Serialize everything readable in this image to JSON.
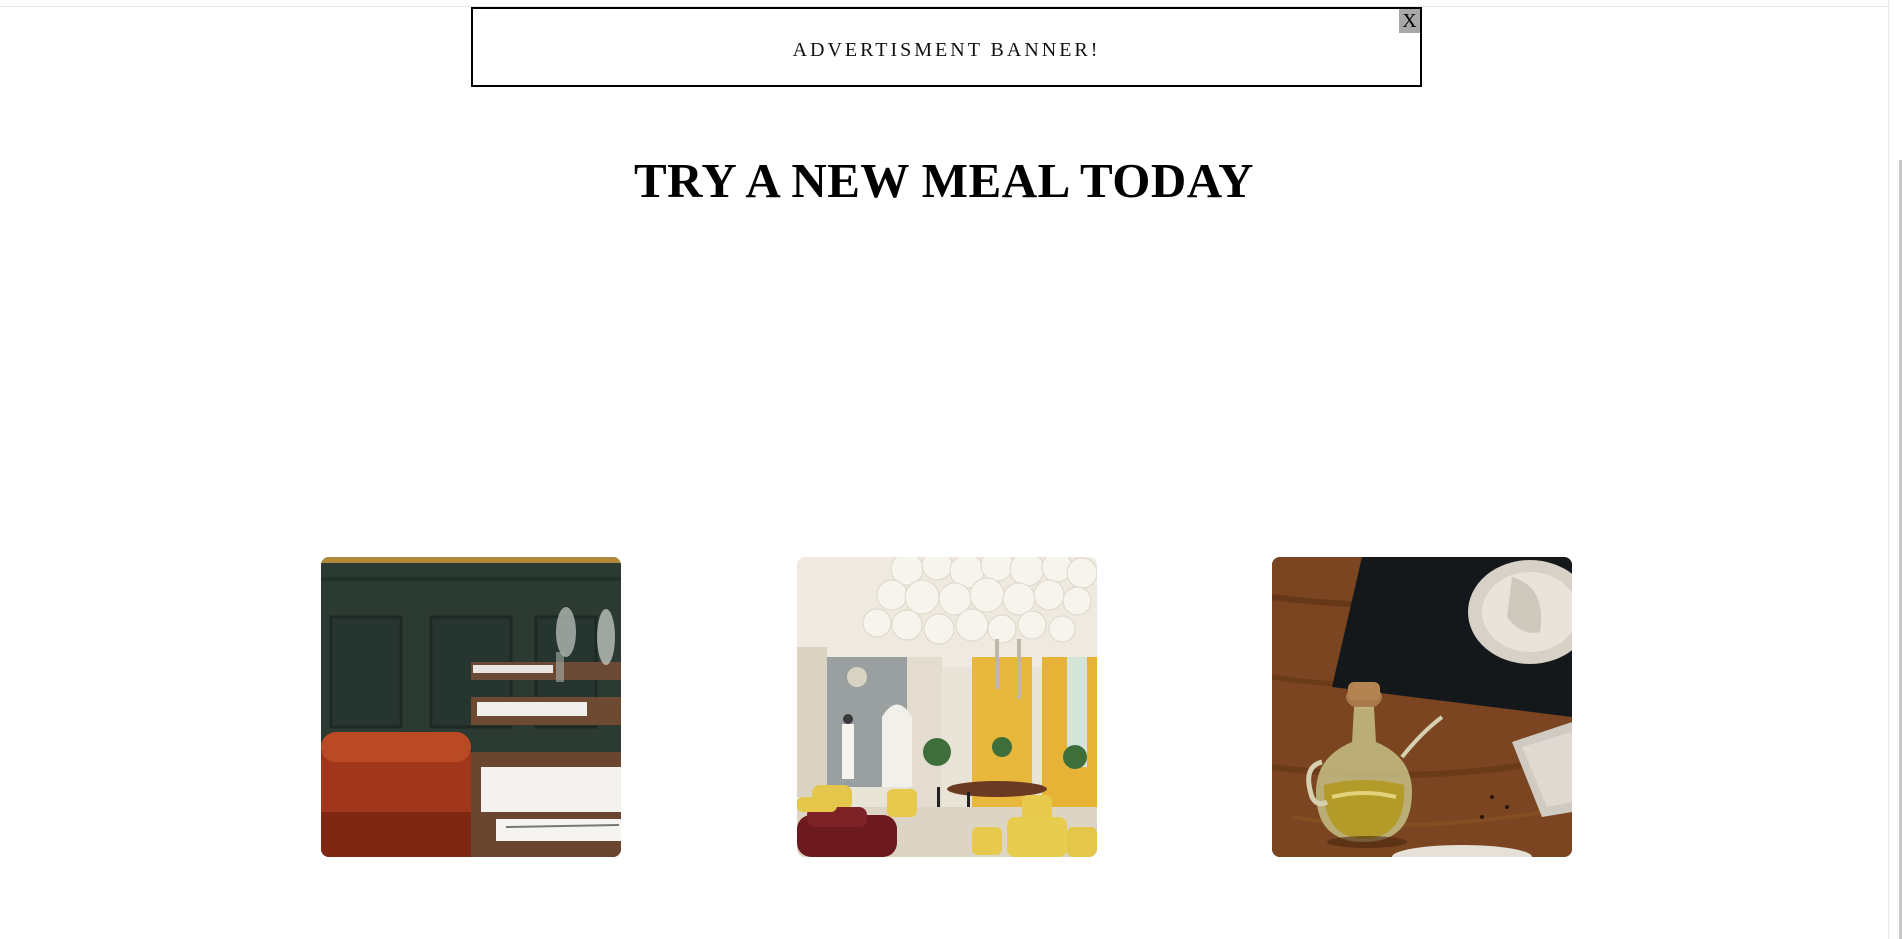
{
  "ad_banner": {
    "text": "ADVERTISMENT BANNER!",
    "close_label": "X"
  },
  "headline": "TRY A NEW MEAL TODAY",
  "gallery": [
    {
      "name": "restaurant-tables-photo"
    },
    {
      "name": "yellow-dining-room-photo"
    },
    {
      "name": "olive-oil-bottle-photo"
    }
  ],
  "colors": {
    "background": "#ffffff",
    "banner_border": "#000000",
    "close_button_bg": "#a8a8a8"
  }
}
